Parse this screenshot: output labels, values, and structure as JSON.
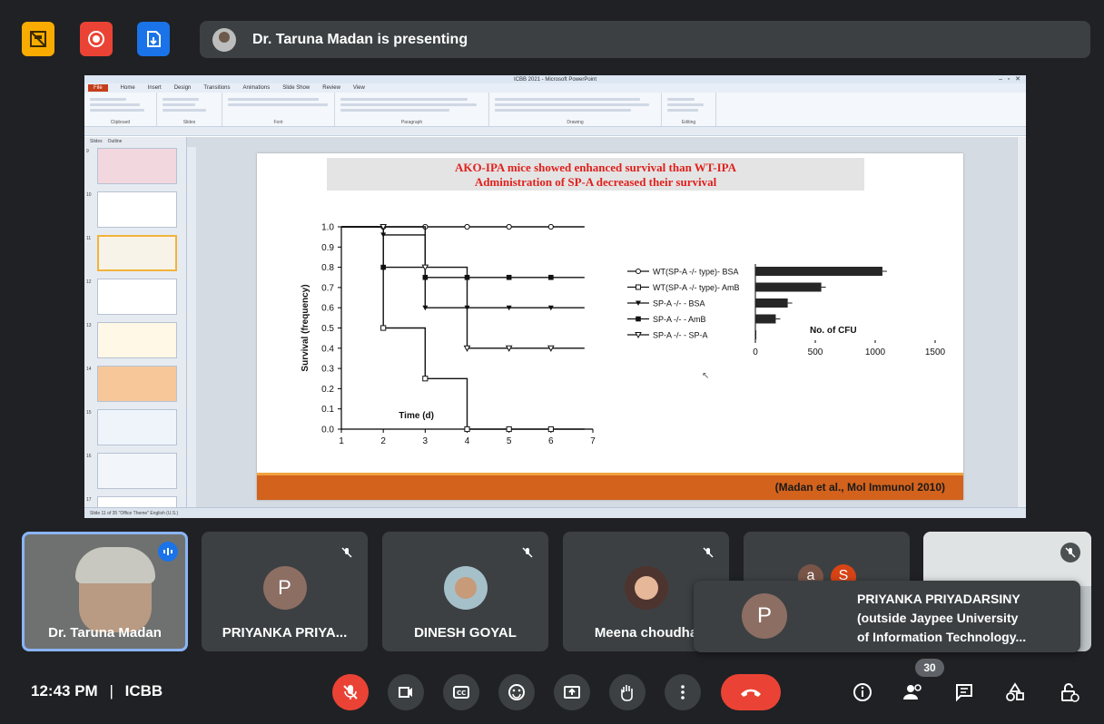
{
  "meeting": {
    "presenting_text": "Dr. Taruna Madan is presenting",
    "time": "12:43 PM",
    "separator": "|",
    "meeting_code": "ICBB",
    "participant_count": "30"
  },
  "ppt": {
    "window_title": "ICBB 2021 - Microsoft PowerPoint",
    "tabs": [
      "File",
      "Home",
      "Insert",
      "Design",
      "Transitions",
      "Animations",
      "Slide Show",
      "Review",
      "View"
    ],
    "groups": [
      "Clipboard",
      "Slides",
      "Font",
      "Paragraph",
      "Drawing",
      "Editing"
    ],
    "panel_tabs": [
      "Slides",
      "Outline"
    ],
    "thumb_numbers": [
      "9",
      "10",
      "11",
      "12",
      "13",
      "14",
      "15",
      "16",
      "17"
    ],
    "status_text": "Slide 11 of 35   \"Office Theme\"   English (U.S.)"
  },
  "slide": {
    "title_line1": "AKO-IPA mice showed enhanced survival than WT-IPA",
    "title_line2": "Administration of SP-A decreased their survival",
    "citation": "(Madan et al., Mol Immunol 2010)"
  },
  "chart_data": [
    {
      "type": "line",
      "ylabel": "Survival (frequency)",
      "xlabel_annotation": "Time (d)",
      "xlim": [
        1,
        7
      ],
      "ylim": [
        0,
        1
      ],
      "x_ticks": [
        "1",
        "2",
        "3",
        "4",
        "5",
        "6",
        "7"
      ],
      "y_ticks": [
        "0.0",
        "0.1",
        "0.2",
        "0.3",
        "0.4",
        "0.5",
        "0.6",
        "0.7",
        "0.8",
        "0.9",
        "1.0"
      ],
      "step": true,
      "series": [
        {
          "name": "WT(SP-A -/- type)- BSA",
          "marker": "open-circle",
          "x": [
            1,
            2,
            6.8
          ],
          "y": [
            1,
            1,
            1
          ]
        },
        {
          "name": "WT(SP-A -/- type)- AmB",
          "marker": "open-square",
          "x": [
            1,
            2,
            2,
            3,
            3,
            4,
            4,
            5,
            6.8
          ],
          "y": [
            1,
            1,
            0.5,
            0.5,
            0.25,
            0.25,
            0,
            0,
            0
          ]
        },
        {
          "name": "SP-A -/- - BSA",
          "marker": "filled-triangle",
          "x": [
            1,
            2,
            2,
            3,
            3,
            6.8
          ],
          "y": [
            1,
            1,
            0.96,
            0.96,
            0.6,
            0.6
          ]
        },
        {
          "name": "SP-A -/- - AmB",
          "marker": "filled-square",
          "x": [
            1,
            2,
            2,
            3,
            3,
            4,
            4,
            6.8
          ],
          "y": [
            1,
            1,
            0.8,
            0.8,
            0.75,
            0.75,
            0.75,
            0.75
          ]
        },
        {
          "name": "SP-A -/- - SP-A",
          "marker": "open-triangle",
          "x": [
            1,
            3,
            3,
            4,
            4,
            6.8
          ],
          "y": [
            1,
            1,
            0.8,
            0.8,
            0.4,
            0.4
          ]
        }
      ],
      "markers_at": [
        2,
        3,
        4,
        5,
        6
      ]
    },
    {
      "type": "bar",
      "orientation": "horizontal",
      "title": "No. of CFU",
      "categories": [
        "WT(SP-A -/- type)- BSA",
        "WT(SP-A -/- type)- AmB",
        "SP-A -/- - BSA",
        "SP-A -/- - AmB",
        "SP-A -/- - SP-A"
      ],
      "values": [
        1060,
        550,
        270,
        170,
        8
      ],
      "x_ticks": [
        "0",
        "500",
        "1000",
        "1500"
      ],
      "xlim": [
        0,
        1500
      ]
    }
  ],
  "participants": [
    {
      "name": "Dr. Taruna Madan"
    },
    {
      "name": "PRIYANKA PRIYA...",
      "initial": "P"
    },
    {
      "name": "DINESH GOYAL"
    },
    {
      "name": "Meena choudha"
    },
    {
      "initials": [
        "a",
        "S"
      ]
    }
  ],
  "popup": {
    "initial": "P",
    "line1": "PRIYANKA PRIYADARSINY",
    "line2": "(outside Jaypee University",
    "line3": "of Information Technology..."
  },
  "colors": {
    "bg": "#202124",
    "tile": "#3c4043",
    "end_call": "#ea4335",
    "muted": "#ea4335",
    "title_red": "#e0201c",
    "footer_orange": "#d3621c",
    "active_border": "#8ab4f8"
  },
  "icons": [
    "highlight-off-icon",
    "record-icon",
    "save-icon",
    "mic-off-icon",
    "camera-icon",
    "captions-icon",
    "emoji-icon",
    "present-icon",
    "hand-icon",
    "more-icon",
    "end-call-icon",
    "info-icon",
    "people-icon",
    "chat-icon",
    "activities-icon",
    "host-controls-icon"
  ]
}
